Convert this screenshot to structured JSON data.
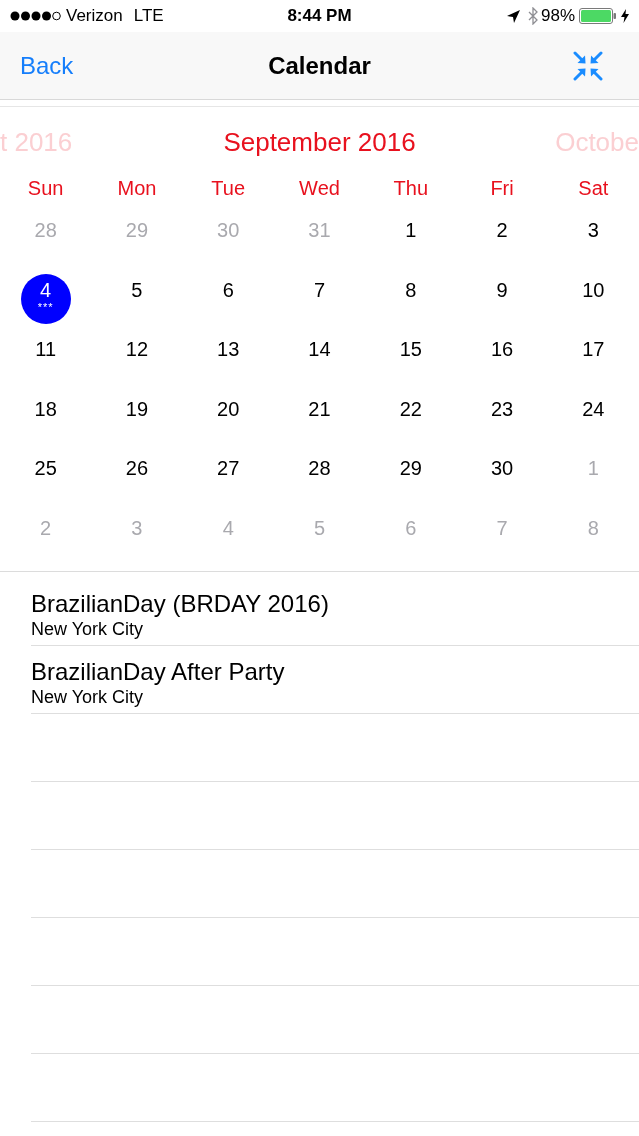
{
  "status_bar": {
    "carrier": "Verizon",
    "network": "LTE",
    "time": "8:44 PM",
    "battery": "98%"
  },
  "nav_bar": {
    "back": "Back",
    "title": "Calendar"
  },
  "calendar": {
    "previous_month": "t 2016",
    "month": "September 2016",
    "next_month": "Octobe",
    "weekdays": [
      "Sun",
      "Mon",
      "Tue",
      "Wed",
      "Thu",
      "Fri",
      "Sat"
    ],
    "weeks": [
      [
        {
          "day": "28",
          "in_month": false,
          "selected": false
        },
        {
          "day": "29",
          "in_month": false,
          "selected": false
        },
        {
          "day": "30",
          "in_month": false,
          "selected": false
        },
        {
          "day": "31",
          "in_month": false,
          "selected": false
        },
        {
          "day": "1",
          "in_month": true,
          "selected": false
        },
        {
          "day": "2",
          "in_month": true,
          "selected": false
        },
        {
          "day": "3",
          "in_month": true,
          "selected": false
        }
      ],
      [
        {
          "day": "4",
          "in_month": true,
          "selected": true,
          "marker": "***"
        },
        {
          "day": "5",
          "in_month": true,
          "selected": false
        },
        {
          "day": "6",
          "in_month": true,
          "selected": false
        },
        {
          "day": "7",
          "in_month": true,
          "selected": false
        },
        {
          "day": "8",
          "in_month": true,
          "selected": false
        },
        {
          "day": "9",
          "in_month": true,
          "selected": false
        },
        {
          "day": "10",
          "in_month": true,
          "selected": false
        }
      ],
      [
        {
          "day": "11",
          "in_month": true,
          "selected": false
        },
        {
          "day": "12",
          "in_month": true,
          "selected": false
        },
        {
          "day": "13",
          "in_month": true,
          "selected": false
        },
        {
          "day": "14",
          "in_month": true,
          "selected": false
        },
        {
          "day": "15",
          "in_month": true,
          "selected": false
        },
        {
          "day": "16",
          "in_month": true,
          "selected": false
        },
        {
          "day": "17",
          "in_month": true,
          "selected": false
        }
      ],
      [
        {
          "day": "18",
          "in_month": true,
          "selected": false
        },
        {
          "day": "19",
          "in_month": true,
          "selected": false
        },
        {
          "day": "20",
          "in_month": true,
          "selected": false
        },
        {
          "day": "21",
          "in_month": true,
          "selected": false
        },
        {
          "day": "22",
          "in_month": true,
          "selected": false
        },
        {
          "day": "23",
          "in_month": true,
          "selected": false
        },
        {
          "day": "24",
          "in_month": true,
          "selected": false
        }
      ],
      [
        {
          "day": "25",
          "in_month": true,
          "selected": false
        },
        {
          "day": "26",
          "in_month": true,
          "selected": false
        },
        {
          "day": "27",
          "in_month": true,
          "selected": false
        },
        {
          "day": "28",
          "in_month": true,
          "selected": false
        },
        {
          "day": "29",
          "in_month": true,
          "selected": false
        },
        {
          "day": "30",
          "in_month": true,
          "selected": false
        },
        {
          "day": "1",
          "in_month": false,
          "selected": false
        }
      ],
      [
        {
          "day": "2",
          "in_month": false,
          "selected": false
        },
        {
          "day": "3",
          "in_month": false,
          "selected": false
        },
        {
          "day": "4",
          "in_month": false,
          "selected": false
        },
        {
          "day": "5",
          "in_month": false,
          "selected": false
        },
        {
          "day": "6",
          "in_month": false,
          "selected": false
        },
        {
          "day": "7",
          "in_month": false,
          "selected": false
        },
        {
          "day": "8",
          "in_month": false,
          "selected": false
        }
      ]
    ]
  },
  "events": [
    {
      "title": "BrazilianDay (BRDAY 2016)",
      "location": "New York City"
    },
    {
      "title": "BrazilianDay After Party",
      "location": "New York City"
    }
  ]
}
